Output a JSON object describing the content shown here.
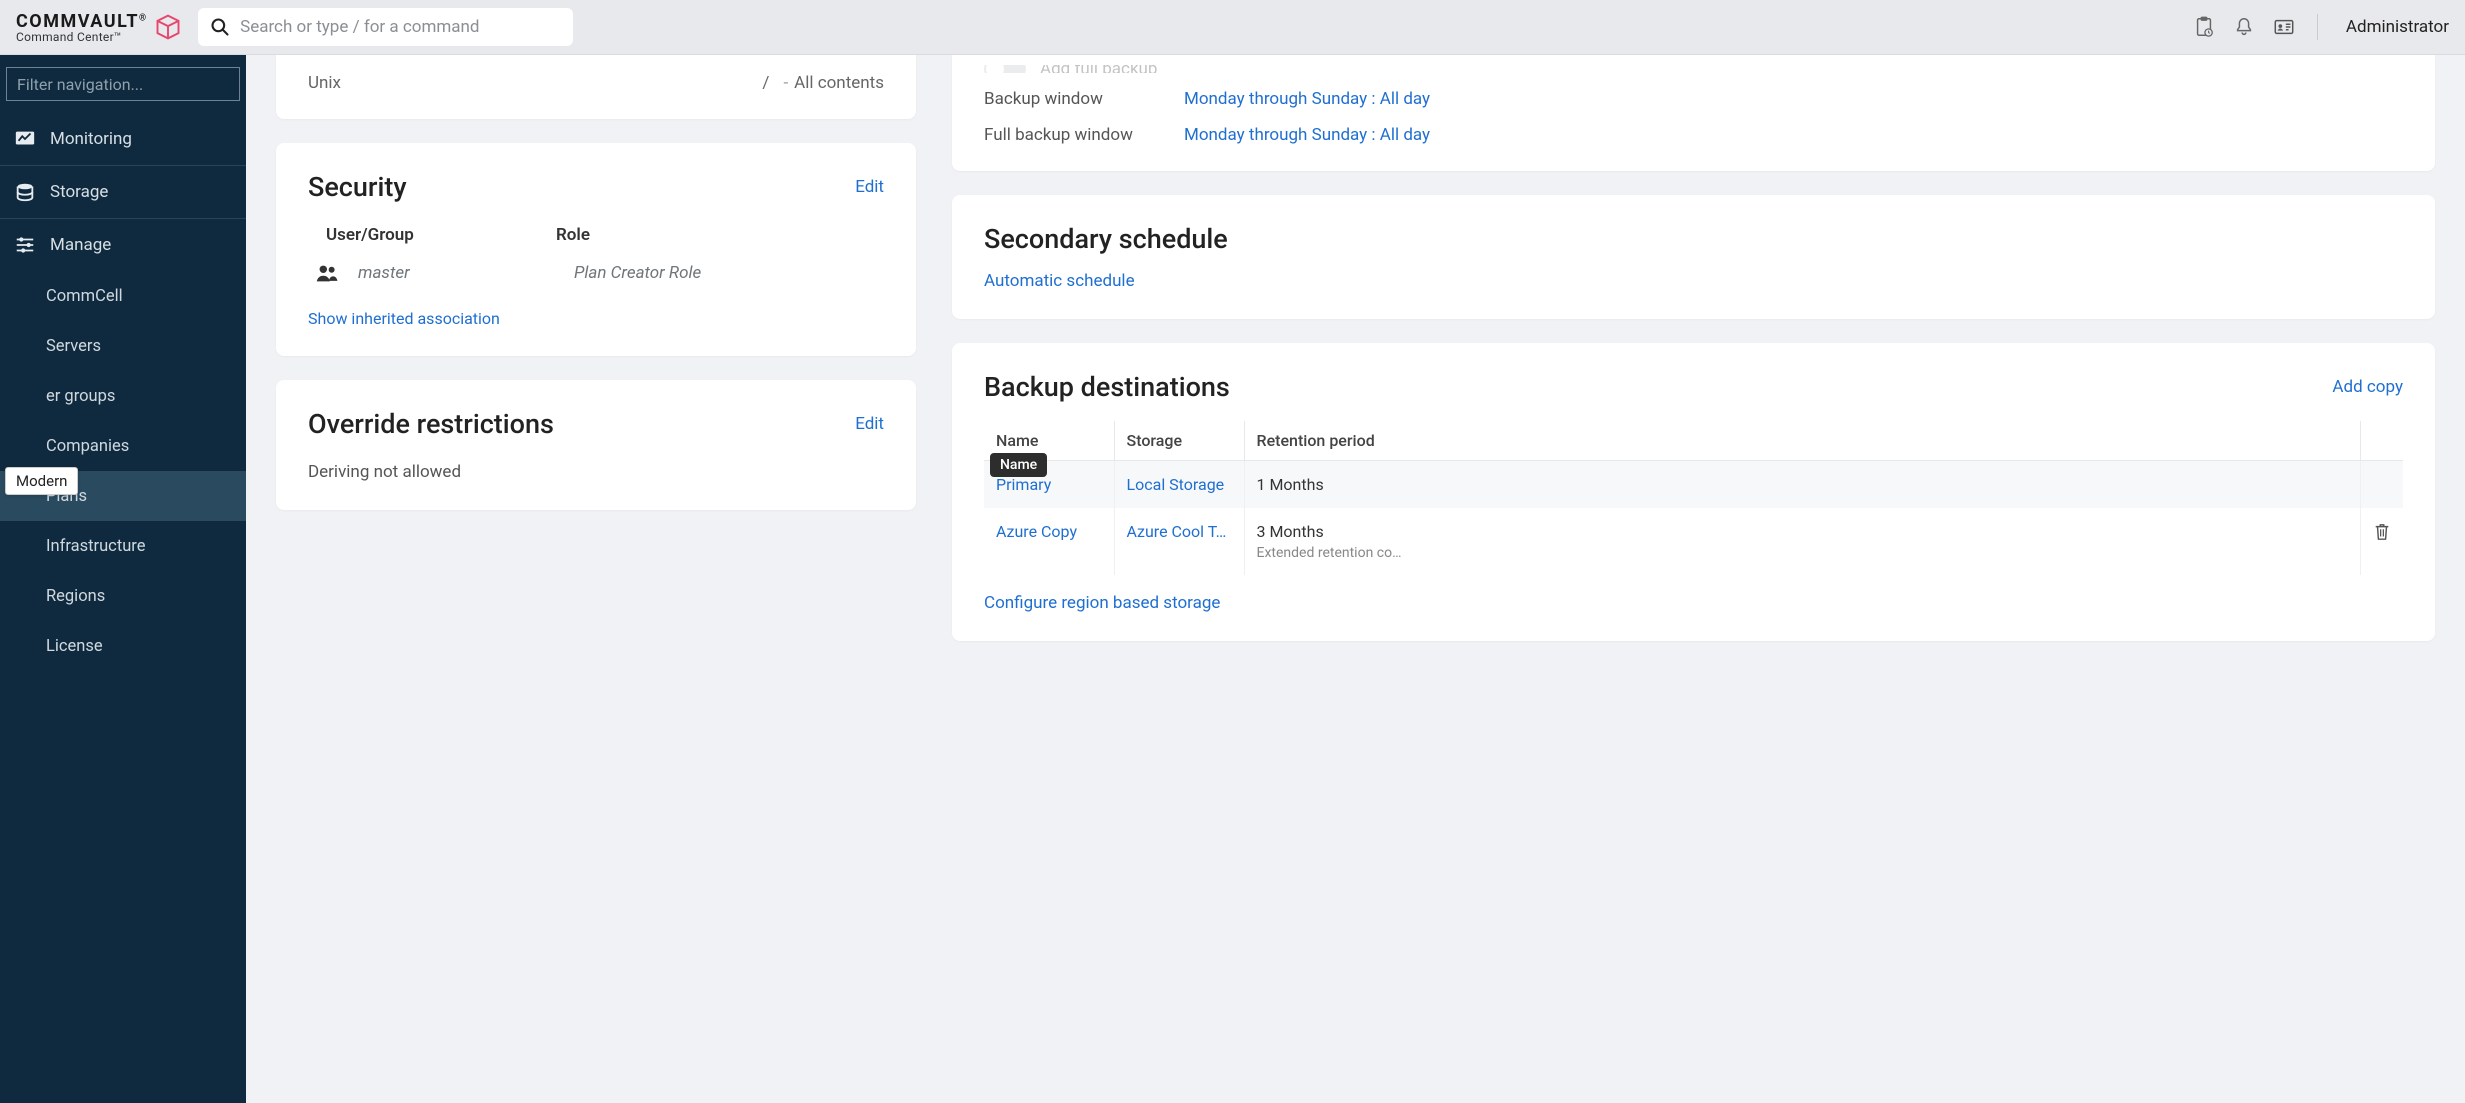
{
  "header": {
    "logo_main": "COMMVAULT",
    "logo_sub": "Command Center™",
    "search_placeholder": "Search or type / for a command",
    "user": "Administrator"
  },
  "sidebar": {
    "filter_placeholder": "Filter navigation...",
    "modern_tooltip": "Modern",
    "items": [
      {
        "label": "Monitoring"
      },
      {
        "label": "Storage"
      },
      {
        "label": "Manage"
      }
    ],
    "sub": {
      "commcell": "CommCell",
      "servers": "Servers",
      "server_groups": "er groups",
      "companies": "Companies",
      "plans": "Plans",
      "infrastructure": "Infrastructure",
      "regions": "Regions",
      "license": "License"
    }
  },
  "content_card": {
    "os": "Unix",
    "sep": "/",
    "dash": "-",
    "all": "All contents"
  },
  "security": {
    "title": "Security",
    "edit": "Edit",
    "col_user": "User/Group",
    "col_role": "Role",
    "user": "master",
    "role": "Plan Creator Role",
    "show_inherited": "Show inherited association"
  },
  "override": {
    "title": "Override restrictions",
    "edit": "Edit",
    "text": "Deriving not allowed"
  },
  "rpo": {
    "toggle_label": "Add full backup",
    "backup_window_label": "Backup window",
    "backup_window_value": "Monday through Sunday : All day",
    "full_window_label": "Full backup window",
    "full_window_value": "Monday through Sunday : All day"
  },
  "secondary": {
    "title": "Secondary schedule",
    "link": "Automatic schedule"
  },
  "destinations": {
    "title": "Backup destinations",
    "add_copy": "Add copy",
    "cols": {
      "name": "Name",
      "storage": "Storage",
      "retention": "Retention period"
    },
    "name_tooltip": "Name",
    "rows": [
      {
        "name": "Primary",
        "storage": "Local Storage",
        "retention": "1 Months",
        "retention_sub": "",
        "deletable": false
      },
      {
        "name": "Azure Copy",
        "storage": "Azure Cool T…",
        "retention": "3 Months",
        "retention_sub": "Extended retention co…",
        "deletable": true
      }
    ],
    "configure_region": "Configure region based storage"
  }
}
